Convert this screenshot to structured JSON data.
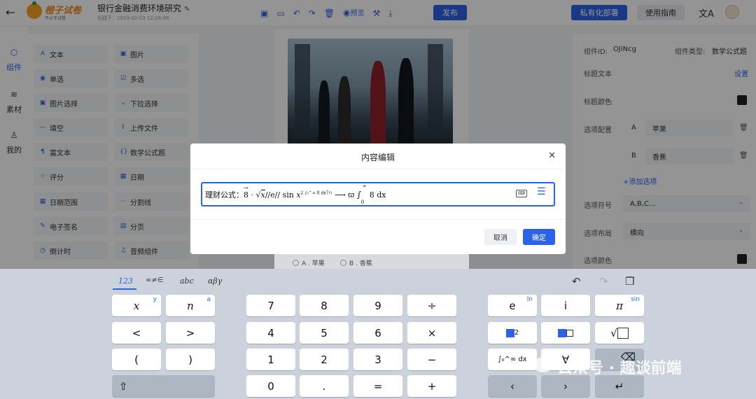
{
  "header": {
    "brand": "橙子试卷",
    "brand_sub": "不止于试卷",
    "doc_title": "银行金融消费环境研究",
    "created": "创建于：2024-02-03 12:28:49",
    "preview_label": "预览",
    "publish_label": "发布",
    "private_deploy_label": "私有化部署",
    "guide_label": "使用指南"
  },
  "rail": {
    "items": [
      {
        "label": "组件",
        "icon": "cube-icon"
      },
      {
        "label": "素材",
        "icon": "layers-icon"
      },
      {
        "label": "我的",
        "icon": "user-icon"
      }
    ]
  },
  "components": [
    {
      "label": "文本",
      "icon": "A"
    },
    {
      "label": "图片",
      "icon": "▣"
    },
    {
      "label": "单选",
      "icon": "◉"
    },
    {
      "label": "多选",
      "icon": "☑"
    },
    {
      "label": "图片选择",
      "icon": "▣"
    },
    {
      "label": "下拉选择",
      "icon": "⌄"
    },
    {
      "label": "填空",
      "icon": "—"
    },
    {
      "label": "上传文件",
      "icon": "⇪"
    },
    {
      "label": "富文本",
      "icon": "¶"
    },
    {
      "label": "数学公式题",
      "icon": "{}"
    },
    {
      "label": "评分",
      "icon": "☆"
    },
    {
      "label": "日期",
      "icon": "▦"
    },
    {
      "label": "日期范围",
      "icon": "▦"
    },
    {
      "label": "分割线",
      "icon": "⋯"
    },
    {
      "label": "电子签名",
      "icon": "✎"
    },
    {
      "label": "分页",
      "icon": "▤"
    },
    {
      "label": "倒计时",
      "icon": "◷"
    },
    {
      "label": "音频组件",
      "icon": "♫"
    }
  ],
  "canvas": {
    "options": [
      "A . 苹果",
      "B . 香蕉"
    ]
  },
  "right_panel": {
    "component_id_label": "组件ID:",
    "component_id": "OJiNcg",
    "component_type_label": "组件类型:",
    "component_type": "数学公式题",
    "title_text_label": "标题文本",
    "settings_link": "设置",
    "title_color_label": "标题颜色",
    "title_color": "#222222",
    "options_config_label": "选项配置",
    "options": [
      {
        "key": "A",
        "value": "苹果"
      },
      {
        "key": "B",
        "value": "香蕉"
      }
    ],
    "add_option": "+添加选项",
    "option_symbol_label": "选项符号",
    "option_symbol_value": "A,B,C...",
    "option_layout_label": "选项布局",
    "option_layout_value": "横向",
    "option_color_label": "选项颜色",
    "option_color": "#222222"
  },
  "modal": {
    "title": "内容编辑",
    "formula": {
      "prefix": "理财公式：",
      "vec": "8",
      "dot": " · √",
      "x": "x",
      "mid": "//e//",
      "sin": " sin ",
      "sx": "x",
      "sup": "2 ∫₀^∞ 8 dx7∩",
      "arrow": " ⟶ ϖ ",
      "int": "∫",
      "int_up": "∞",
      "int_low": "0",
      "tail": "8 dx"
    },
    "cancel_label": "取消",
    "ok_label": "确定"
  },
  "keyboard": {
    "tabs": [
      "123",
      "∞≠∈",
      "abc",
      "αβγ"
    ],
    "active_tab": "123",
    "left_keys": [
      {
        "label": "x",
        "sup": "y"
      },
      {
        "label": "n",
        "sup": "a"
      },
      {
        "label": "<"
      },
      {
        "label": ">"
      },
      {
        "label": "("
      },
      {
        "label": ")"
      }
    ],
    "shift": "⇧",
    "num_keys": [
      "7",
      "8",
      "9",
      "÷",
      "4",
      "5",
      "6",
      "×",
      "1",
      "2",
      "3",
      "−",
      "0",
      ".",
      "=",
      "+"
    ],
    "func_keys": [
      {
        "label": "e",
        "sup": "ln"
      },
      {
        "label": "i"
      },
      {
        "label": "π",
        "sup": "sin"
      },
      {
        "label": "2"
      },
      {
        "label": "√"
      },
      {
        "label": "∫₀^∞ dx"
      },
      {
        "label": "∀"
      },
      {
        "label": "⌫"
      },
      {
        "label": "‹"
      },
      {
        "label": "›"
      },
      {
        "label": "↵"
      }
    ]
  },
  "watermark": "公众号 · 趣谈前端"
}
